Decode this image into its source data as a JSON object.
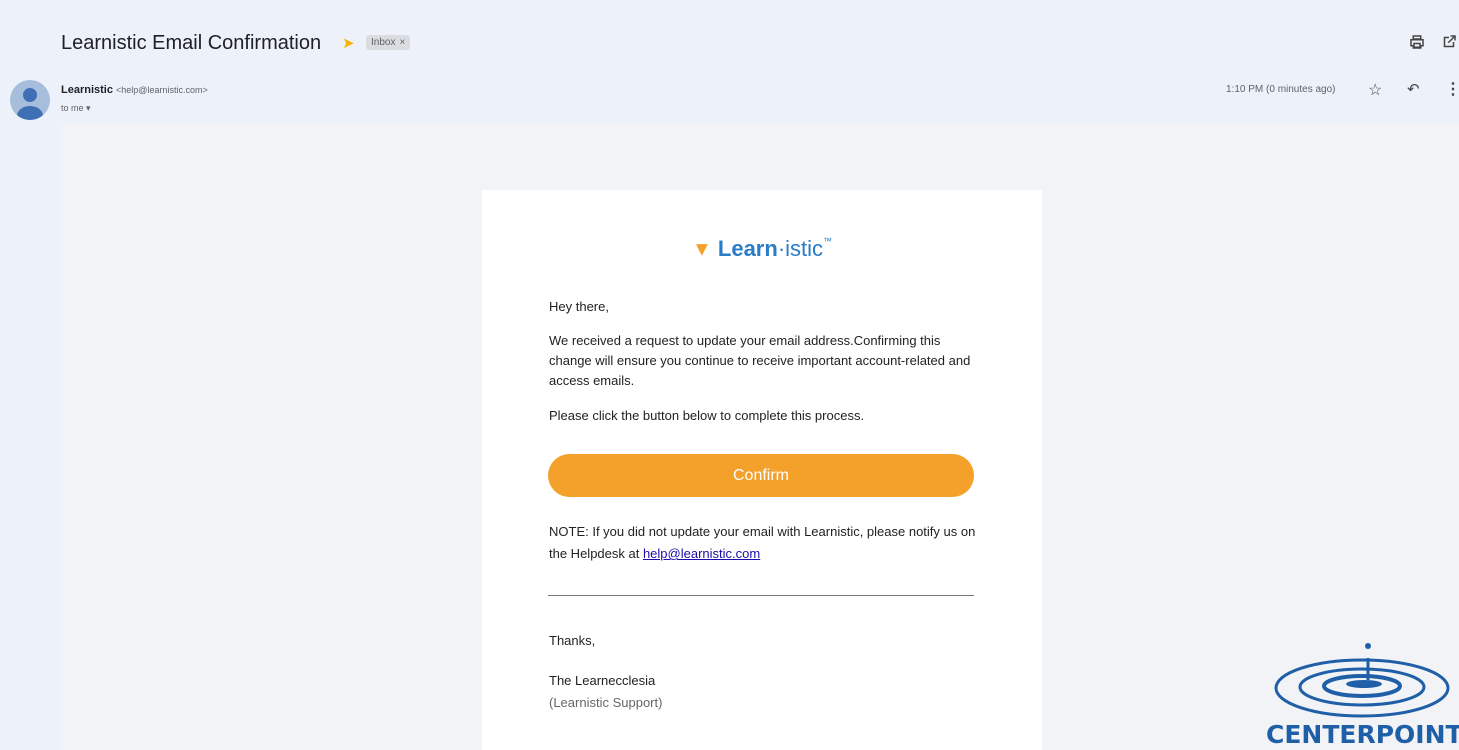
{
  "email": {
    "subject": "Learnistic Email Confirmation",
    "label_chip": "Inbox",
    "label_chip_close": "×",
    "sender_name": "Learnistic",
    "sender_email": "<help@learnistic.com>",
    "recipient": "to me",
    "timestamp": "1:10 PM (0 minutes ago)"
  },
  "icons": {
    "importance": "importance-marker-icon",
    "print": "print-icon",
    "new_window": "open-in-new-window-icon",
    "star": "star-icon",
    "reply": "reply-icon",
    "more": "more-vertical-icon",
    "recipient_dropdown": "chevron-down-icon"
  },
  "body": {
    "logo_bold": "Learn",
    "logo_dot": "·",
    "logo_light": "istic",
    "logo_tm": "™",
    "greeting": "Hey there,",
    "paragraph_1": "We received a request to update your email address.Confirming this change will ensure you continue to receive important account-related and access emails.",
    "paragraph_2": "Please click the button below to complete this process.",
    "confirm_button": "Confirm",
    "note_text": "NOTE: If you did not update your email with Learnistic, please notify us on the Helpdesk at ",
    "note_link": "help@learnistic.com",
    "thanks": "Thanks,",
    "signature_name": "The Learnecclesia",
    "signature_role": "(Learnistic Support)"
  },
  "watermark": {
    "text": "CENTERPOINTE"
  },
  "colors": {
    "accent_orange": "#f4a12c",
    "brand_blue": "#2a7cc7",
    "watermark_blue": "#1f5fa8",
    "page_bg": "#edf2fa"
  }
}
